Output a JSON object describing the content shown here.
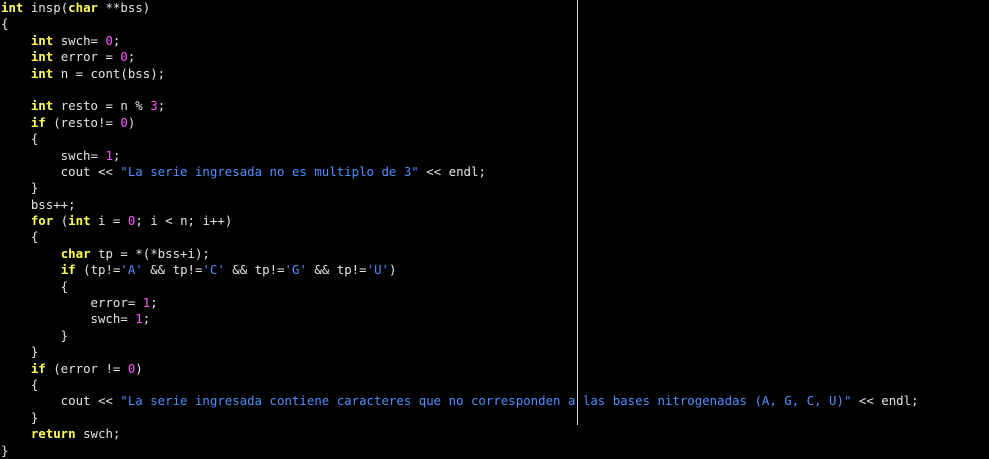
{
  "editor": {
    "lines": [
      [
        {
          "t": "int",
          "c": "type"
        },
        {
          "t": " insp(",
          "c": "plain"
        },
        {
          "t": "char",
          "c": "type"
        },
        {
          "t": " **bss)",
          "c": "plain"
        }
      ],
      [
        {
          "t": "{",
          "c": "plain"
        }
      ],
      [
        {
          "t": "    ",
          "c": "plain"
        },
        {
          "t": "int",
          "c": "type"
        },
        {
          "t": " swch= ",
          "c": "plain"
        },
        {
          "t": "0",
          "c": "num"
        },
        {
          "t": ";",
          "c": "plain"
        }
      ],
      [
        {
          "t": "    ",
          "c": "plain"
        },
        {
          "t": "int",
          "c": "type"
        },
        {
          "t": " error = ",
          "c": "plain"
        },
        {
          "t": "0",
          "c": "num"
        },
        {
          "t": ";",
          "c": "plain"
        }
      ],
      [
        {
          "t": "    ",
          "c": "plain"
        },
        {
          "t": "int",
          "c": "type"
        },
        {
          "t": " n = cont(bss);",
          "c": "plain"
        }
      ],
      [],
      [
        {
          "t": "    ",
          "c": "plain"
        },
        {
          "t": "int",
          "c": "type"
        },
        {
          "t": " resto = n % ",
          "c": "plain"
        },
        {
          "t": "3",
          "c": "num"
        },
        {
          "t": ";",
          "c": "plain"
        }
      ],
      [
        {
          "t": "    ",
          "c": "plain"
        },
        {
          "t": "if",
          "c": "kw"
        },
        {
          "t": " (resto!= ",
          "c": "plain"
        },
        {
          "t": "0",
          "c": "num"
        },
        {
          "t": ")",
          "c": "plain"
        }
      ],
      [
        {
          "t": "    {",
          "c": "plain"
        }
      ],
      [
        {
          "t": "        swch= ",
          "c": "plain"
        },
        {
          "t": "1",
          "c": "num"
        },
        {
          "t": ";",
          "c": "plain"
        }
      ],
      [
        {
          "t": "        cout << ",
          "c": "plain"
        },
        {
          "t": "\"La serie ingresada no es multiplo de 3\"",
          "c": "str"
        },
        {
          "t": " << endl;",
          "c": "plain"
        }
      ],
      [
        {
          "t": "    }",
          "c": "plain"
        }
      ],
      [
        {
          "t": "    bss++;",
          "c": "plain"
        }
      ],
      [
        {
          "t": "    ",
          "c": "plain"
        },
        {
          "t": "for",
          "c": "kw"
        },
        {
          "t": " (",
          "c": "plain"
        },
        {
          "t": "int",
          "c": "type"
        },
        {
          "t": " i = ",
          "c": "plain"
        },
        {
          "t": "0",
          "c": "num"
        },
        {
          "t": "; i < n; i++)",
          "c": "plain"
        }
      ],
      [
        {
          "t": "    {",
          "c": "plain"
        }
      ],
      [
        {
          "t": "        ",
          "c": "plain"
        },
        {
          "t": "char",
          "c": "type"
        },
        {
          "t": " tp = *(*bss+i);",
          "c": "plain"
        }
      ],
      [
        {
          "t": "        ",
          "c": "plain"
        },
        {
          "t": "if",
          "c": "kw"
        },
        {
          "t": " (tp!=",
          "c": "plain"
        },
        {
          "t": "'A'",
          "c": "str"
        },
        {
          "t": " && tp!=",
          "c": "plain"
        },
        {
          "t": "'C'",
          "c": "str"
        },
        {
          "t": " && tp!=",
          "c": "plain"
        },
        {
          "t": "'G'",
          "c": "str"
        },
        {
          "t": " && tp!=",
          "c": "plain"
        },
        {
          "t": "'U'",
          "c": "str"
        },
        {
          "t": ")",
          "c": "plain"
        }
      ],
      [
        {
          "t": "        {",
          "c": "plain"
        }
      ],
      [
        {
          "t": "            error= ",
          "c": "plain"
        },
        {
          "t": "1",
          "c": "num"
        },
        {
          "t": ";",
          "c": "plain"
        }
      ],
      [
        {
          "t": "            swch= ",
          "c": "plain"
        },
        {
          "t": "1",
          "c": "num"
        },
        {
          "t": ";",
          "c": "plain"
        }
      ],
      [
        {
          "t": "        }",
          "c": "plain"
        }
      ],
      [
        {
          "t": "    }",
          "c": "plain"
        }
      ],
      [
        {
          "t": "    ",
          "c": "plain"
        },
        {
          "t": "if",
          "c": "kw"
        },
        {
          "t": " (error != ",
          "c": "plain"
        },
        {
          "t": "0",
          "c": "num"
        },
        {
          "t": ")",
          "c": "plain"
        }
      ],
      [
        {
          "t": "    {",
          "c": "plain"
        }
      ],
      [
        {
          "t": "        cout << ",
          "c": "plain"
        },
        {
          "t": "\"La serie ingresada contiene caracteres que no corresponden a las bases nitrogenadas (A, G, C, U)\"",
          "c": "str"
        },
        {
          "t": " << endl;",
          "c": "plain"
        }
      ],
      [
        {
          "t": "    }",
          "c": "plain"
        }
      ],
      [
        {
          "t": "    ",
          "c": "plain"
        },
        {
          "t": "return",
          "c": "kw"
        },
        {
          "t": " swch;",
          "c": "plain"
        }
      ],
      [
        {
          "t": "}",
          "c": "plain"
        }
      ]
    ]
  },
  "colors": {
    "background": "#000000",
    "keyword": "#ffff55",
    "number": "#ff55ff",
    "string": "#4f8fff",
    "text": "#e4e4e4",
    "ruler": "#d8d8d8"
  }
}
